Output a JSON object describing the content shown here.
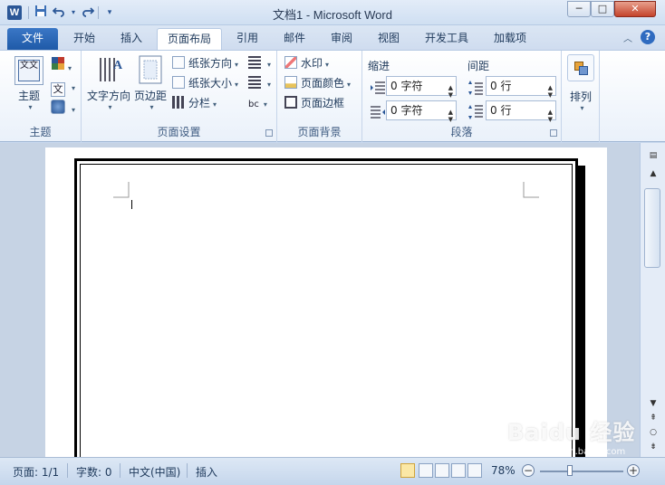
{
  "window": {
    "title": "文档1 - Microsoft Word"
  },
  "qat": {
    "app_icon": "W",
    "save_icon": "floppy-icon",
    "undo_icon": "undo-icon",
    "redo_icon": "redo-icon",
    "customize_icon": "chevron-down-icon"
  },
  "window_controls": {
    "minimize": "─",
    "maximize": "□",
    "close": "✕"
  },
  "tabs": [
    {
      "label": "文件"
    },
    {
      "label": "开始"
    },
    {
      "label": "插入"
    },
    {
      "label": "页面布局"
    },
    {
      "label": "引用"
    },
    {
      "label": "邮件"
    },
    {
      "label": "审阅"
    },
    {
      "label": "视图"
    },
    {
      "label": "开发工具"
    },
    {
      "label": "加载项"
    }
  ],
  "ribbon": {
    "themes": {
      "group_label": "主题",
      "theme_button": "主题",
      "theme_icon_text": "文文"
    },
    "page_setup": {
      "group_label": "页面设置",
      "text_direction": "文字方向",
      "margins": "页边距",
      "orientation": "纸张方向",
      "size": "纸张大小",
      "columns": "分栏"
    },
    "page_background": {
      "group_label": "页面背景",
      "watermark": "水印",
      "page_color": "页面颜色",
      "page_borders": "页面边框"
    },
    "paragraph": {
      "group_label": "段落",
      "indent_label": "缩进",
      "spacing_label": "间距",
      "indent_left": "0 字符",
      "indent_right": "0 字符",
      "spacing_before": "0 行",
      "spacing_after": "0 行"
    },
    "arrange": {
      "label": "排列"
    }
  },
  "status": {
    "page": "页面: 1/1",
    "words": "字数: 0",
    "language": "中文(中国)",
    "mode": "插入",
    "zoom": "78%"
  },
  "overlay": {
    "logo_text": "Baidu 经验",
    "logo_sub": "jingyan.baidu.com"
  },
  "colors": {
    "accent": "#2b5797",
    "file_tab": "#2a63b0"
  }
}
